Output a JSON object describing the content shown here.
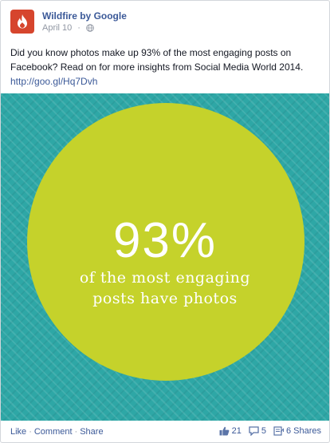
{
  "post": {
    "page_name": "Wildfire by Google",
    "date": "April 10",
    "message": "Did you know photos make up 93% of the most engaging posts on Facebook? Read on for more insights from Social Media World 2014.",
    "link": "http://goo.gl/Hq7Dvh"
  },
  "image": {
    "big_number": "93%",
    "caption_line1": "of the most engaging",
    "caption_line2": "posts have photos"
  },
  "footer": {
    "like": "Like",
    "comment": "Comment",
    "share": "Share",
    "likes_count": "21",
    "comments_count": "5",
    "shares_count": "6 Shares"
  }
}
